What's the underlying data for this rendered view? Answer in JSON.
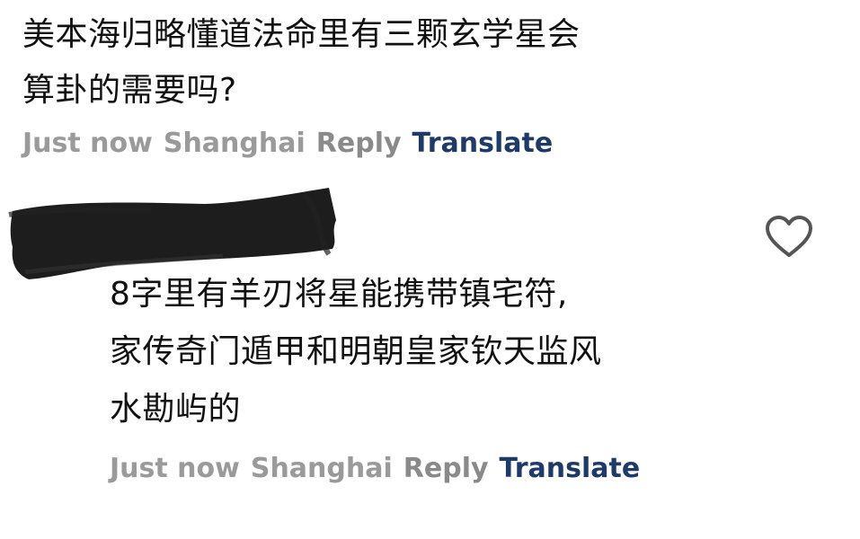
{
  "comments": [
    {
      "text": "美本海归略懂道法命里有三颗玄学星会\n算卦的需要吗?",
      "time": "Just now",
      "location": "Shanghai",
      "reply_label": "Reply",
      "translate_label": "Translate"
    },
    {
      "text": "8字里有羊刃将星能携带镇宅符,\n家传奇门遁甲和明朝皇家钦天监风\n水勘屿的",
      "time": "Just now",
      "location": "Shanghai",
      "reply_label": "Reply",
      "translate_label": "Translate",
      "like_icon": "heart-outline-icon"
    }
  ],
  "colors": {
    "meta_gray": "#9a9a9a",
    "translate_blue": "#1f3a66",
    "text": "#111111",
    "redaction": "#111111"
  }
}
